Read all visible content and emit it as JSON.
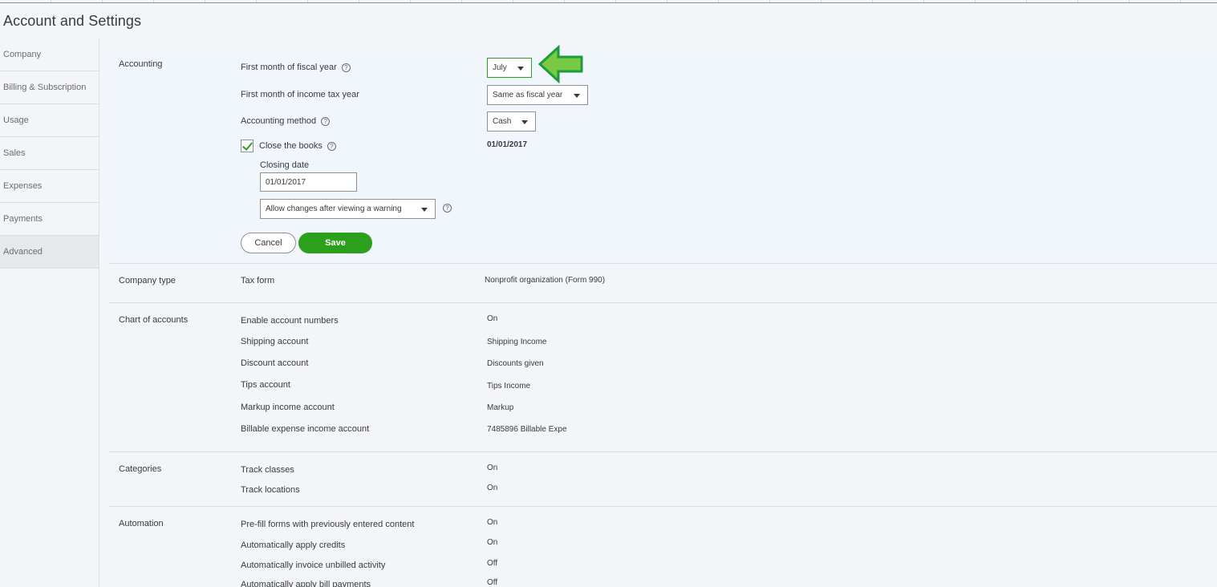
{
  "title": "Account and Settings",
  "sidebar": {
    "items": [
      {
        "label": "Company"
      },
      {
        "label": "Billing & Subscription"
      },
      {
        "label": "Usage"
      },
      {
        "label": "Sales"
      },
      {
        "label": "Expenses"
      },
      {
        "label": "Payments"
      },
      {
        "label": "Advanced"
      }
    ]
  },
  "accounting": {
    "title": "Accounting",
    "fiscal_year_label": "First month of fiscal year",
    "fiscal_year_value": "July",
    "tax_year_label": "First month of income tax year",
    "tax_year_value": "Same as fiscal year",
    "method_label": "Accounting method",
    "method_value": "Cash",
    "close_books_label": "Close the books",
    "close_books_checked": true,
    "close_books_value": "01/01/2017",
    "closing_date_label": "Closing date",
    "closing_date_value": "01/01/2017",
    "changes_option": "Allow changes after viewing a warning",
    "cancel_label": "Cancel",
    "save_label": "Save",
    "help_glyph": "?"
  },
  "company_type": {
    "title": "Company type",
    "tax_form_label": "Tax form",
    "tax_form_value": "Nonprofit organization (Form 990)"
  },
  "chart_of_accounts": {
    "title": "Chart of accounts",
    "rows": [
      {
        "label": "Enable account numbers",
        "value": "On"
      },
      {
        "label": "Shipping account",
        "value": "Shipping Income"
      },
      {
        "label": "Discount account",
        "value": "Discounts given"
      },
      {
        "label": "Tips account",
        "value": "Tips Income"
      },
      {
        "label": "Markup income account",
        "value": "Markup"
      },
      {
        "label": "Billable expense income account",
        "value": "7485896 Billable Expe"
      }
    ]
  },
  "categories": {
    "title": "Categories",
    "rows": [
      {
        "label": "Track classes",
        "value": "On"
      },
      {
        "label": "Track locations",
        "value": "On"
      }
    ]
  },
  "automation": {
    "title": "Automation",
    "rows": [
      {
        "label": "Pre-fill forms with previously entered content",
        "value": "On"
      },
      {
        "label": "Automatically apply credits",
        "value": "On"
      },
      {
        "label": "Automatically invoice unbilled activity",
        "value": "Off"
      },
      {
        "label": "Automatically apply bill payments",
        "value": "Off"
      }
    ]
  },
  "colors": {
    "accent_green": "#2ca01c",
    "arrow_fill": "#7ac943",
    "arrow_stroke": "#1a9c3e"
  }
}
